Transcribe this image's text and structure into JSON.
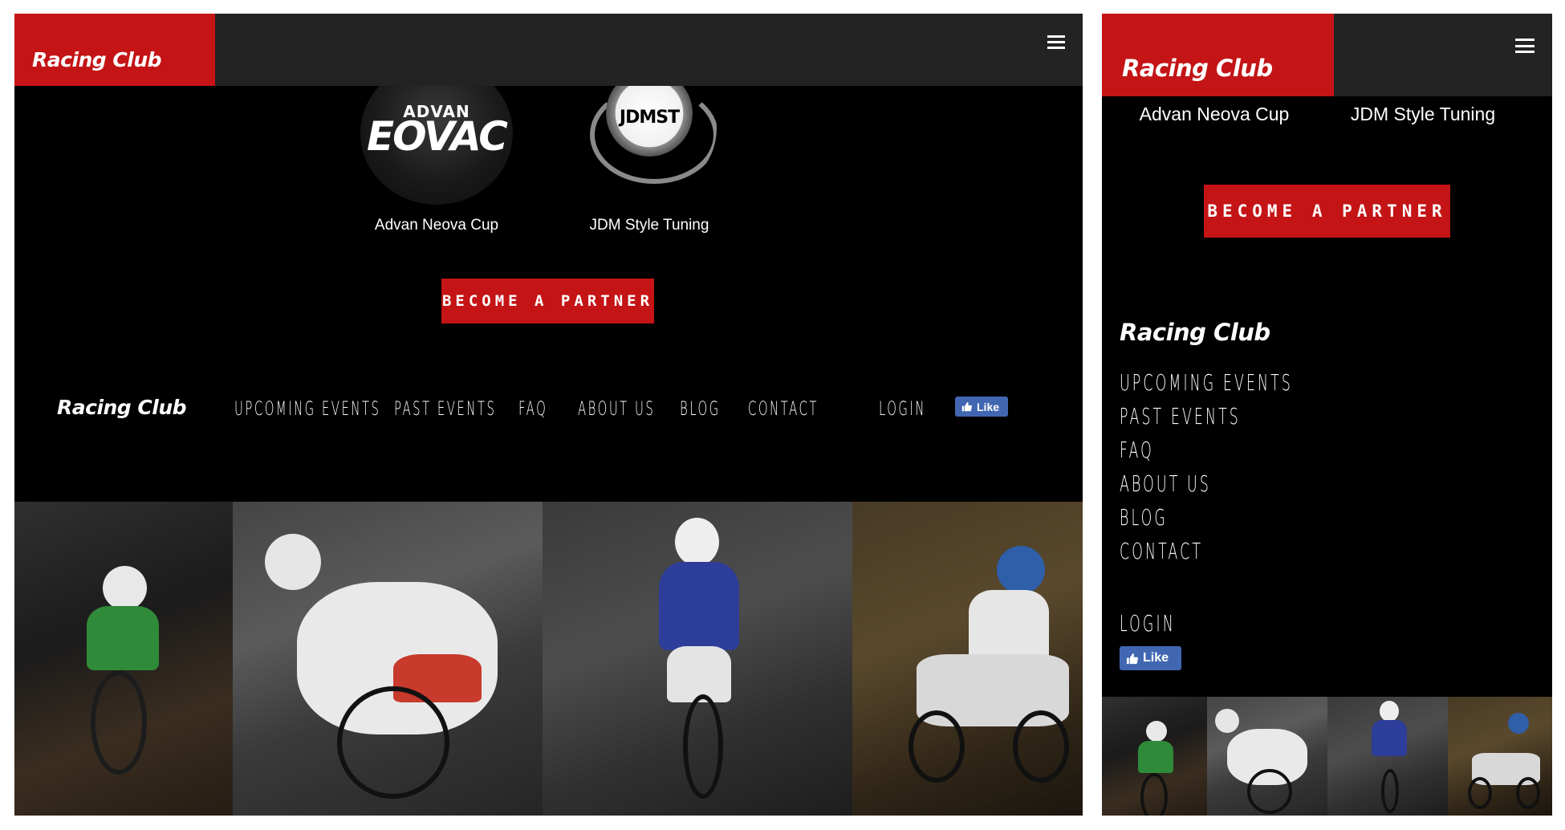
{
  "desktop": {
    "header": {
      "brand": "Racing Club",
      "menu_icon": "hamburger-menu-icon"
    },
    "partners": [
      {
        "name": "Advan Neova Cup",
        "logo_top": "ADVAN",
        "logo_main": "EOVAC"
      },
      {
        "name": "JDM Style Tuning",
        "logo_main": "JDMST"
      }
    ],
    "partner_button": "BECOME A PARTNER",
    "footer": {
      "brand": "Racing Club",
      "nav": [
        "UPCOMING EVENTS",
        "PAST EVENTS",
        "FAQ",
        "ABOUT US",
        "BLOG",
        "CONTACT"
      ],
      "login": "LOGIN",
      "like": "Like"
    }
  },
  "mobile": {
    "header": {
      "brand": "Racing Club",
      "menu_icon": "hamburger-menu-icon"
    },
    "partners": [
      {
        "name": "Advan Neova Cup"
      },
      {
        "name": "JDM Style Tuning"
      }
    ],
    "partner_button": "BECOME A PARTNER",
    "footer": {
      "brand": "Racing Club",
      "nav": [
        "UPCOMING EVENTS",
        "PAST EVENTS",
        "FAQ",
        "ABOUT US",
        "BLOG",
        "CONTACT"
      ],
      "login": "LOGIN",
      "like": "Like"
    }
  },
  "colors": {
    "brand_red": "#c41416",
    "header_bg": "#232323",
    "page_bg": "#000000",
    "facebook_blue": "#4267b2"
  }
}
